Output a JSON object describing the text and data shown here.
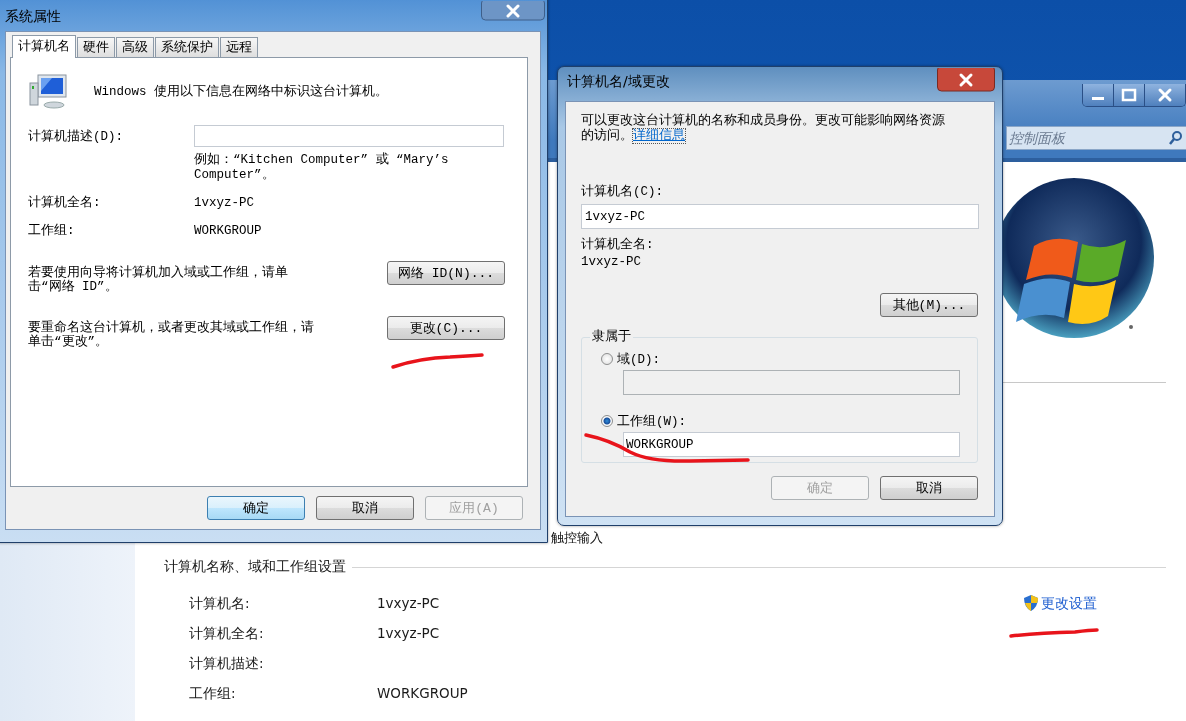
{
  "control_panel": {
    "search": {
      "placeholder": "控制面板"
    },
    "partial_text": "触控输入",
    "section": {
      "title": "计算机名称、域和工作组设置",
      "rows": [
        {
          "label": "计算机名:",
          "value": "1vxyz-PC"
        },
        {
          "label": "计算机全名:",
          "value": "1vxyz-PC"
        },
        {
          "label": "计算机描述:"
        },
        {
          "label": "工作组:",
          "value": "WORKGROUP"
        }
      ],
      "link": "更改设置"
    }
  },
  "system_properties": {
    "title": "系统属性",
    "tabs": [
      {
        "label": "计算机名",
        "selected": true
      },
      {
        "label": "硬件",
        "selected": false
      },
      {
        "label": "高级",
        "selected": false
      },
      {
        "label": "系统保护",
        "selected": false
      },
      {
        "label": "远程",
        "selected": false
      }
    ],
    "intro": "Windows 使用以下信息在网络中标识这台计算机。",
    "description_label": "计算机描述(D):",
    "example": "例如：“Kitchen Computer” 或 “Mary’s Computer”。",
    "info_rows": [
      {
        "label": "计算机全名:",
        "value": "1vxyz-PC"
      },
      {
        "label": "工作组:",
        "value": "WORKGROUP"
      }
    ],
    "actions": [
      {
        "text": "若要使用向导将计算机加入域或工作组，请单击“网络 ID”。",
        "button": "网络 ID(N)..."
      },
      {
        "text": "要重命名这台计算机，或者更改其域或工作组，请单击“更改”。",
        "button": "更改(C)..."
      }
    ],
    "buttons": [
      {
        "label": "确定",
        "default": true,
        "disabled": false
      },
      {
        "label": "取消",
        "default": false,
        "disabled": false
      },
      {
        "label": "应用(A)",
        "default": false,
        "disabled": true
      }
    ]
  },
  "name_change_dialog": {
    "title": "计算机名/域更改",
    "intro": "可以更改这台计算机的名称和成员身份。更改可能影响网络资源的访问。",
    "link": "详细信息",
    "name_label": "计算机名(C):",
    "name_value": "1vxyz-PC",
    "full_name_label": "计算机全名:",
    "full_name_value": "1vxyz-PC",
    "more_button": "其他(M)...",
    "member_of": {
      "title": "隶属于",
      "options": [
        {
          "label": "域(D):",
          "selected": false
        },
        {
          "label": "工作组(W):",
          "selected": true,
          "value": "WORKGROUP"
        }
      ]
    },
    "buttons": [
      {
        "label": "确定",
        "default": false,
        "disabled": true
      },
      {
        "label": "取消",
        "default": false,
        "disabled": false
      }
    ]
  }
}
